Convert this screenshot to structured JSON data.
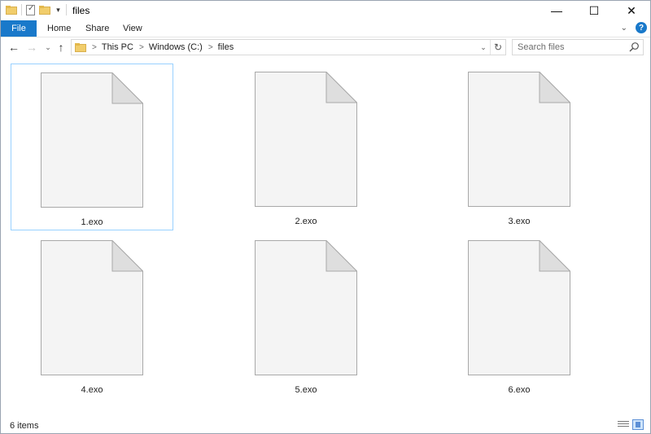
{
  "window": {
    "title": "files",
    "controls": {
      "minimize": "—",
      "maximize": "☐",
      "close": "✕"
    }
  },
  "qat": {
    "customize_glyph": "▾"
  },
  "ribbon": {
    "tabs": [
      {
        "label": "File"
      },
      {
        "label": "Home"
      },
      {
        "label": "Share"
      },
      {
        "label": "View"
      }
    ],
    "expand_glyph": "⌄",
    "help_glyph": "?"
  },
  "navigation": {
    "back_glyph": "←",
    "forward_glyph": "→",
    "recent_glyph": "⌄",
    "up_glyph": "↑",
    "breadcrumb": [
      "This PC",
      "Windows (C:)",
      "files"
    ],
    "crumb_sep": ">",
    "dropdown_glyph": "⌄",
    "refresh_glyph": "↻"
  },
  "search": {
    "placeholder": "Search files"
  },
  "files": [
    {
      "name": "1.exo",
      "selected": true
    },
    {
      "name": "2.exo",
      "selected": false
    },
    {
      "name": "3.exo",
      "selected": false
    },
    {
      "name": "4.exo",
      "selected": false
    },
    {
      "name": "5.exo",
      "selected": false
    },
    {
      "name": "6.exo",
      "selected": false
    }
  ],
  "status": {
    "item_count": "6 items"
  },
  "colors": {
    "accent": "#1979ca",
    "selection_border": "#99d1ff",
    "folder": "#f1cd6b"
  }
}
